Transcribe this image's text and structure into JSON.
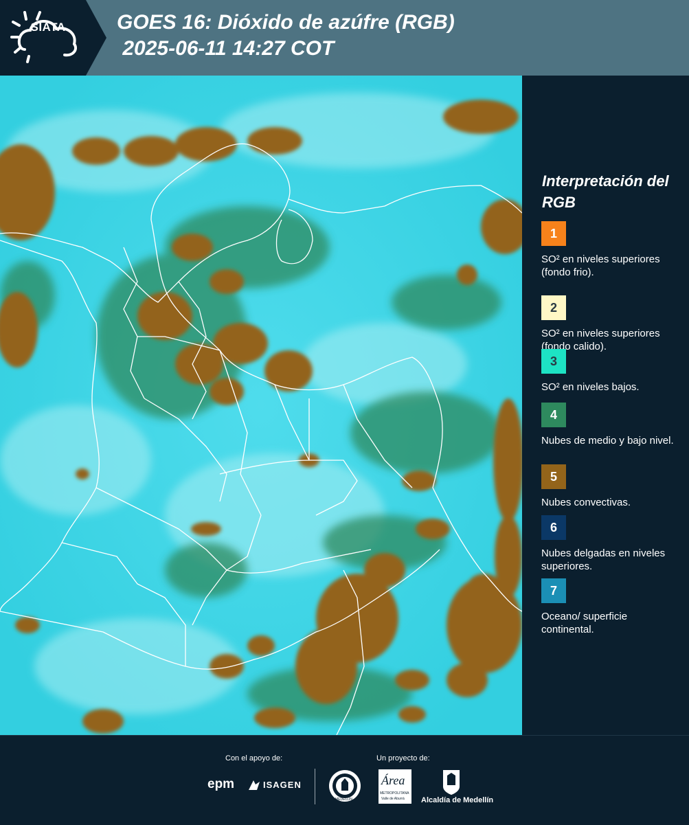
{
  "header": {
    "logo_text": "SIATA",
    "title_line1": "GOES 16: Dióxido de azúfre (RGB)",
    "title_line2": " 2025-06-11 14:27 COT"
  },
  "legend": {
    "title": "Interpretación del RGB",
    "items": [
      {
        "num": "1",
        "color": "#f7821b",
        "num_color": "#ffffff",
        "label": "SO² en niveles superiores (fondo frio)."
      },
      {
        "num": "2",
        "color": "#fff8c6",
        "num_color": "#2a3a44",
        "label": "SO² en niveles superiores (fondo calido)."
      },
      {
        "num": "3",
        "color": "#1de3c4",
        "num_color": "#2a3a44",
        "label": "SO² en niveles bajos."
      },
      {
        "num": "4",
        "color": "#2e8a5e",
        "num_color": "#ffffff",
        "label": "Nubes de medio y bajo nivel."
      },
      {
        "num": "5",
        "color": "#93641a",
        "num_color": "#ffffff",
        "label": "Nubes convectivas."
      },
      {
        "num": "6",
        "color": "#0b3866",
        "num_color": "#ffffff",
        "label": "Nubes delgadas en niveles superiores."
      },
      {
        "num": "7",
        "color": "#1b8fb5",
        "num_color": "#ffffff",
        "label": "Oceano/ superficie continental."
      }
    ]
  },
  "footer": {
    "support_label": "Con el apoyo de:",
    "project_label": "Un proyecto de:",
    "logo_epm": "epm",
    "logo_isagen": "ISAGEN",
    "logo_area_main": "Área",
    "logo_area_sub1": "METROPOLITANA",
    "logo_area_sub2": "Valle de Aburrá",
    "logo_alcaldia": "Alcaldía de Medellín",
    "logo_medellin": "MEDELLÍN"
  },
  "colors": {
    "header_dark": "#0b1f2e",
    "header_band": "#4e7382",
    "map_cyan": "#45d6e6",
    "cloud_brown": "#93641a",
    "cloud_green": "#2e8a5e",
    "borders": "#ffffff"
  }
}
